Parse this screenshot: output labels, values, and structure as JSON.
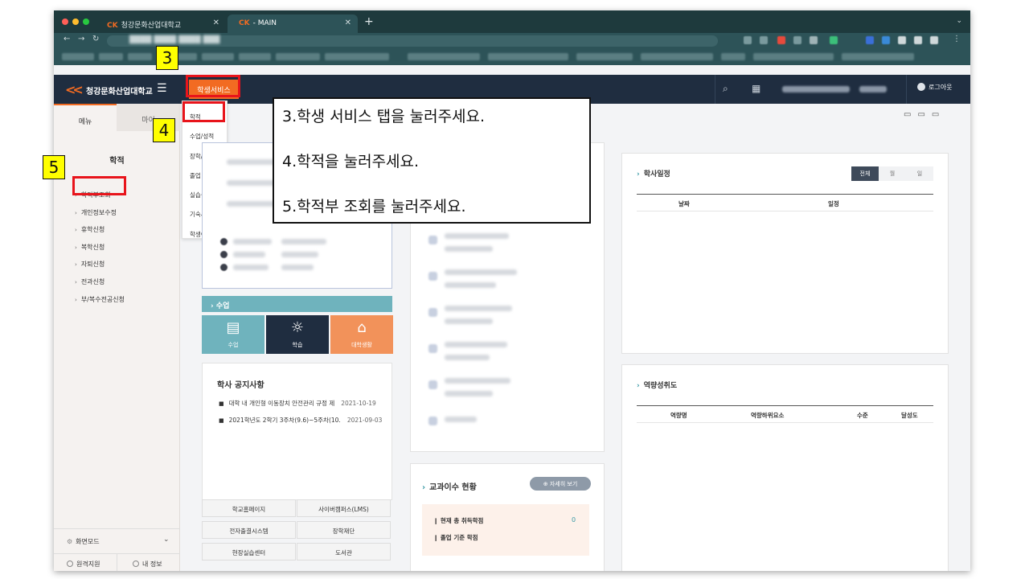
{
  "browser": {
    "tabs": [
      {
        "label": "청강문화산업대학교",
        "active": false
      },
      {
        "label": "- MAIN",
        "active": true
      }
    ],
    "logo_glyph": "CK"
  },
  "header": {
    "site_name": "청강문화산업대학교",
    "menu_tab": "학생서비스",
    "logout": "로그아웃"
  },
  "sidebar": {
    "tabs": [
      "메뉴",
      "마이"
    ],
    "title": "학적",
    "items": [
      "학적부조회",
      "개인정보수정",
      "휴학신청",
      "복학신청",
      "자퇴신청",
      "전과신청",
      "부/복수전공신청"
    ],
    "screen_mode": "화면모드",
    "remote_support": "원격지원",
    "my_info": "내 정보"
  },
  "dropdown": {
    "items": [
      "학적",
      "수업/성적",
      "장학/등록",
      "졸업",
      "실습실",
      "기숙사",
      "학생이력"
    ]
  },
  "class_section": {
    "title": "수업",
    "tiles": [
      {
        "label": "수업",
        "color": "#6fb3bd",
        "icon": "document-icon"
      },
      {
        "label": "학습",
        "color": "#1f2d40",
        "icon": "lightbulb-icon"
      },
      {
        "label": "대학생활",
        "color": "#f2925a",
        "icon": "graduation-cap-icon"
      }
    ]
  },
  "notice": {
    "title": "학사 공지사항",
    "items": [
      {
        "text": "대학 내 개인형 이동장치 안전관리 규정 제",
        "date": "2021-10-19"
      },
      {
        "text": "2021학년도 2학기 3주차(9.6)~5주차(10.",
        "date": "2021-09-03"
      }
    ]
  },
  "quick_links": [
    "학교홈페이지",
    "사이버캠퍼스(LMS)",
    "전자출결시스템",
    "장학재단",
    "현장실습센터",
    "도서관"
  ],
  "curriculum": {
    "title": "교과이수 현황",
    "detail_button": "자세히 보기",
    "rows": [
      "현재 총 취득학점",
      "졸업 기준 학점"
    ],
    "current_credits": "0"
  },
  "schedule": {
    "title": "학사일정",
    "segments": [
      "전체",
      "월",
      "일"
    ],
    "columns": [
      "날짜",
      "일정"
    ]
  },
  "competency": {
    "title": "역량성취도",
    "columns": [
      "역량명",
      "역량하위요소",
      "수준",
      "달성도"
    ]
  },
  "annotations": {
    "instructions": [
      "3.학생 서비스 탭을 눌러주세요.",
      "4.학적을 눌러주세요.",
      "5.학적부 조회를 눌러주세요."
    ],
    "markers": [
      "3",
      "4",
      "5"
    ],
    "highlight_color": "#e8141b",
    "marker_color": "#ffff00"
  }
}
